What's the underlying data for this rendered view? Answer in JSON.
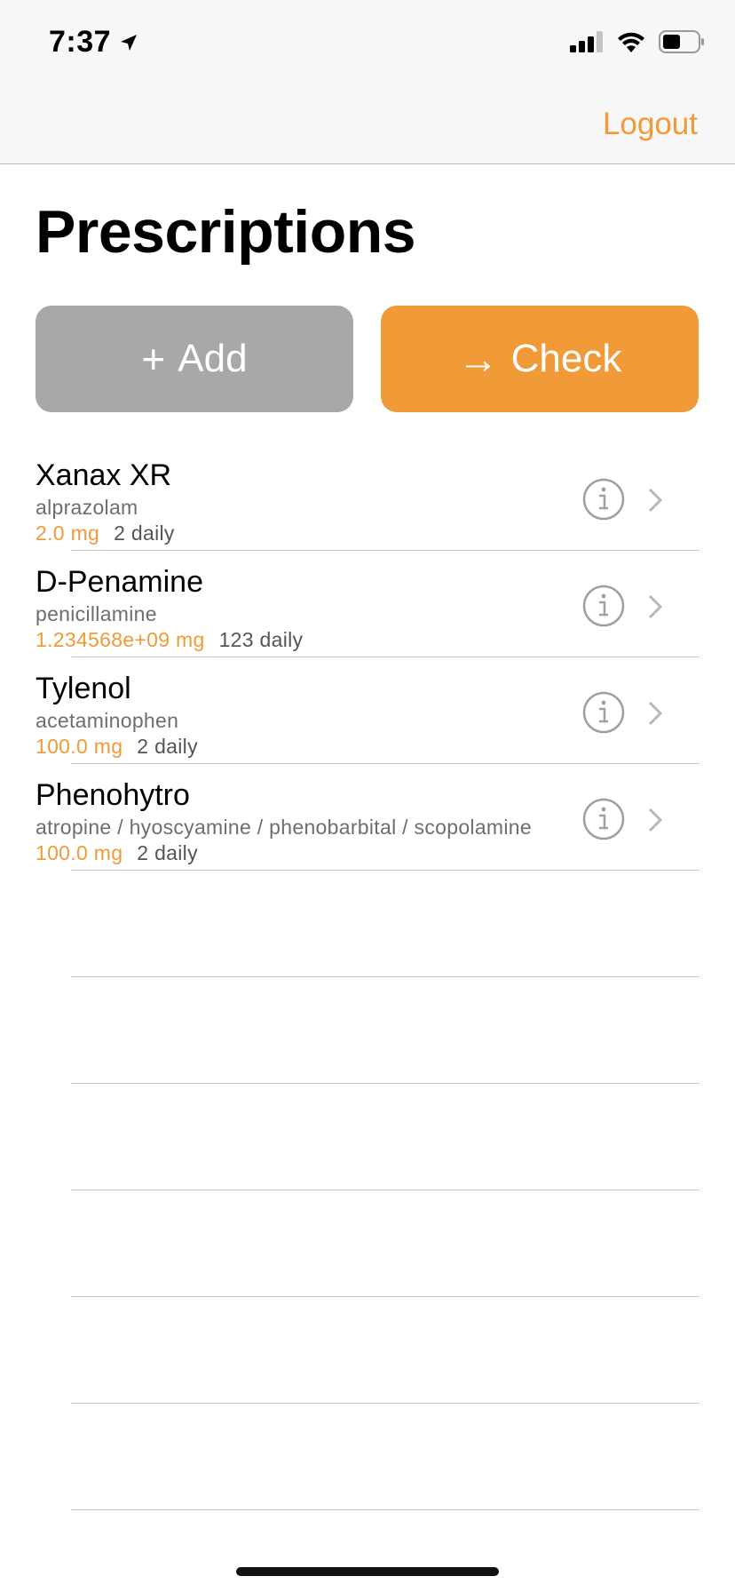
{
  "status_bar": {
    "time": "7:37",
    "location_icon": "location-arrow-icon",
    "signal_icon": "cellular-signal-icon",
    "wifi_icon": "wifi-icon",
    "battery_icon": "battery-icon"
  },
  "nav": {
    "logout_label": "Logout"
  },
  "page": {
    "title": "Prescriptions"
  },
  "actions": {
    "add_glyph": "+",
    "add_label": "Add",
    "check_glyph": "→",
    "check_label": "Check"
  },
  "prescriptions": [
    {
      "name": "Xanax XR",
      "generic": "alprazolam",
      "dose": "2.0 mg",
      "frequency": "2 daily"
    },
    {
      "name": "D-Penamine",
      "generic": "penicillamine",
      "dose": "1.234568e+09 mg",
      "frequency": "123 daily"
    },
    {
      "name": "Tylenol",
      "generic": "acetaminophen",
      "dose": "100.0 mg",
      "frequency": "2 daily"
    },
    {
      "name": "Phenohytro",
      "generic": "atropine / hyoscyamine / phenobarbital / scopolamine",
      "dose": "100.0 mg",
      "frequency": "2 daily"
    }
  ],
  "colors": {
    "accent": "#f09a38",
    "add_button": "#a8a8a8",
    "secondary_text": "#6e6e6e",
    "separator": "#c8c8cc"
  }
}
